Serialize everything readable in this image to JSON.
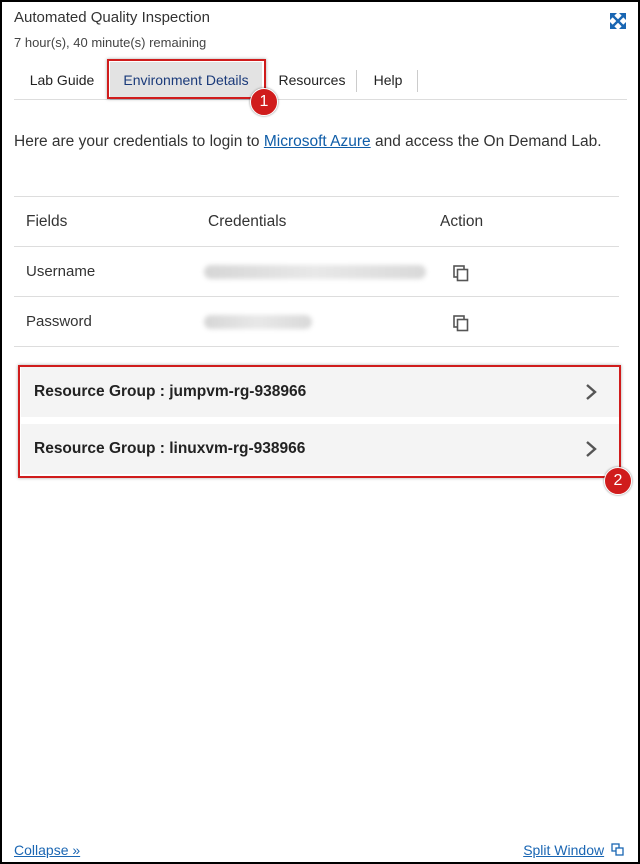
{
  "header": {
    "title": "Automated Quality Inspection",
    "time_remaining": "7 hour(s), 40 minute(s) remaining",
    "expand_icon": "expand-arrows-icon"
  },
  "tabs": [
    {
      "label": "Lab Guide",
      "active": false
    },
    {
      "label": "Environment Details",
      "active": true
    },
    {
      "label": "Resources",
      "active": false
    },
    {
      "label": "Help",
      "active": false
    }
  ],
  "annotations": {
    "badge1": "1",
    "badge2": "2",
    "highlight_color": "#d01c1c"
  },
  "intro": {
    "before": "Here are your credentials to login to ",
    "link": "Microsoft Azure",
    "after": " and access the On Demand Lab."
  },
  "credentials_table": {
    "headers": [
      "Fields",
      "Credentials",
      "Action"
    ],
    "rows": [
      {
        "field": "Username",
        "value_visible": false,
        "action_icon": "copy-icon"
      },
      {
        "field": "Password",
        "value_visible": false,
        "action_icon": "copy-icon"
      }
    ]
  },
  "resource_groups": [
    {
      "label": "Resource Group : jumpvm-rg-938966"
    },
    {
      "label": "Resource Group : linuxvm-rg-938966"
    }
  ],
  "footer": {
    "collapse": "Collapse »",
    "split_window": "Split Window"
  },
  "colors": {
    "link": "#0f5da8",
    "active_tab_bg": "#e3e3e3",
    "accent": "#1a66b3"
  }
}
